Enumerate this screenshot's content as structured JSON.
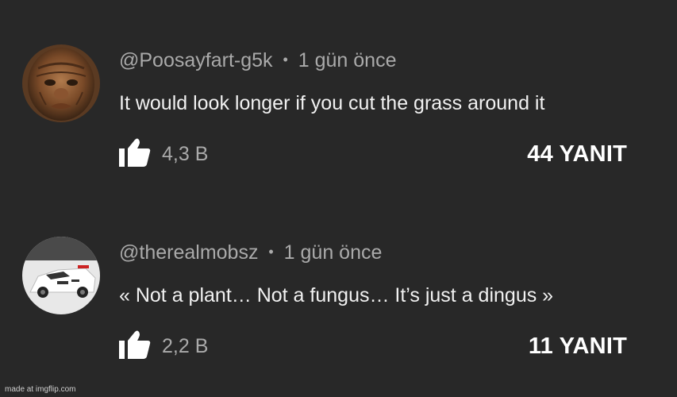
{
  "comments": [
    {
      "username": "@Poosayfart-g5k",
      "separator": "•",
      "time": "1 gün önce",
      "text": "It would look longer if you cut the grass around it",
      "likes": "4,3 B",
      "replies": "44 YANIT"
    },
    {
      "username": "@therealmobsz",
      "separator": "•",
      "time": "1 gün önce",
      "text": "« Not a plant… Not a fungus… It’s just a dingus »",
      "likes": "2,2 B",
      "replies": "11 YANIT"
    }
  ],
  "watermark": "made at imgflip.com",
  "icons": {
    "like": "thumbs-up-icon"
  },
  "colors": {
    "background": "#282828",
    "primary_text": "#f1f1f1",
    "secondary_text": "#aaaaaa"
  }
}
